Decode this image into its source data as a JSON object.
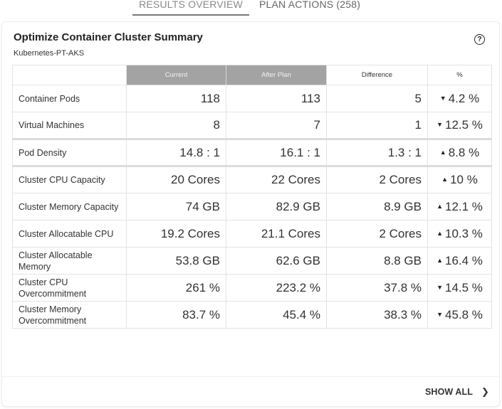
{
  "tabs": [
    {
      "label": "RESULTS OVERVIEW",
      "active": true
    },
    {
      "label": "PLAN ACTIONS (258)",
      "active": false
    }
  ],
  "card": {
    "title": "Optimize Container Cluster Summary",
    "subtitle": "Kubernetes-PT-AKS",
    "help_icon": "question-circle-icon",
    "show_all_label": "SHOW ALL",
    "show_all_icon": "chevron-right-icon"
  },
  "table": {
    "headers": [
      "",
      "Current",
      "After Plan",
      "Difference",
      "%"
    ],
    "rows": [
      {
        "label": "Container Pods",
        "current": "118",
        "after": "113",
        "diff": "5",
        "direction": "down",
        "pct": "4.2 %"
      },
      {
        "label": "Virtual Machines",
        "current": "8",
        "after": "7",
        "diff": "1",
        "direction": "down",
        "pct": "12.5 %"
      },
      {
        "label": "Pod Density",
        "current": "14.8 : 1",
        "after": "16.1 : 1",
        "diff": "1.3 : 1",
        "direction": "up",
        "pct": "8.8 %"
      },
      {
        "label": "Cluster CPU Capacity",
        "current": "20 Cores",
        "after": "22 Cores",
        "diff": "2 Cores",
        "direction": "up",
        "pct": "10 %"
      },
      {
        "label": "Cluster Memory Capacity",
        "current": "74 GB",
        "after": "82.9 GB",
        "diff": "8.9 GB",
        "direction": "up",
        "pct": "12.1 %"
      },
      {
        "label": "Cluster Allocatable CPU",
        "current": "19.2 Cores",
        "after": "21.1 Cores",
        "diff": "2 Cores",
        "direction": "up",
        "pct": "10.3 %"
      },
      {
        "label": "Cluster Allocatable Memory",
        "current": "53.8 GB",
        "after": "62.6 GB",
        "diff": "8.8 GB",
        "direction": "up",
        "pct": "16.4 %"
      },
      {
        "label": "Cluster CPU Overcommitment",
        "current": "261 %",
        "after": "223.2 %",
        "diff": "37.8 %",
        "direction": "down",
        "pct": "14.5 %"
      },
      {
        "label": "Cluster Memory Overcommitment",
        "current": "83.7 %",
        "after": "45.4 %",
        "diff": "38.3 %",
        "direction": "down",
        "pct": "45.8 %"
      }
    ]
  },
  "arrows": {
    "up": "▲",
    "down": "▼"
  }
}
